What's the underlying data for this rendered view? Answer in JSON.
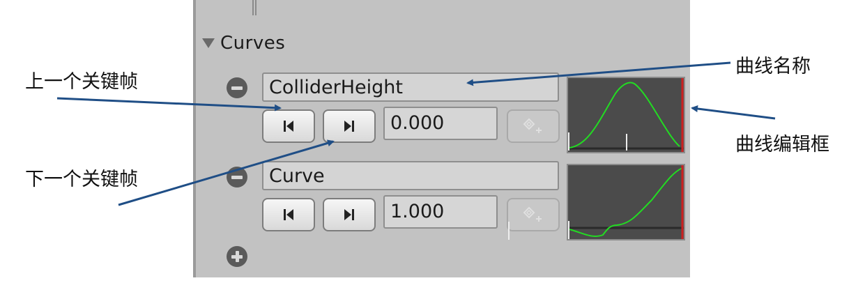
{
  "section": {
    "title": "Curves"
  },
  "curves": [
    {
      "name": "ColliderHeight",
      "value": "0.000"
    },
    {
      "name": "Curve",
      "value": "1.000"
    }
  ],
  "annotations": {
    "prev_keyframe": "上一个关键帧",
    "next_keyframe": "下一个关键帧",
    "curve_name": "曲线名称",
    "curve_editor": "曲线编辑框"
  },
  "icons": {
    "collapse": "triangle-down-icon",
    "remove": "minus-circle-icon",
    "add": "plus-circle-icon",
    "prev": "previous-key-icon",
    "next": "next-key-icon",
    "add_key": "add-key-icon"
  },
  "colors": {
    "panel": "#c2c2c2",
    "curve_line": "#22dd22",
    "curve_bg": "#4b4b4b",
    "time_marker": "#cc2222",
    "annotation_arrow": "#1f4e86"
  }
}
